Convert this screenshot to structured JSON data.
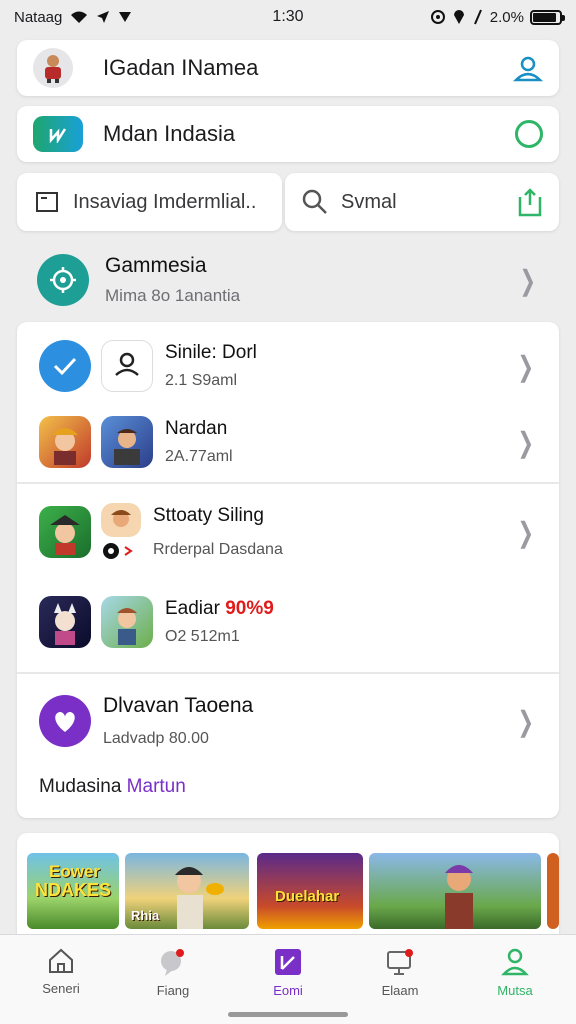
{
  "status_bar": {
    "carrier": "Nataag",
    "time": "1:30",
    "battery_text": "2.0%",
    "battery_level": 0.9
  },
  "profile_card": {
    "name": "IGadan INamea",
    "right_icon": "person-icon"
  },
  "account_card": {
    "name": "Mdan Indasia",
    "right_icon": "circle-icon"
  },
  "search_bar": {
    "left_label": "Insaviag Imdermlial..",
    "right_label": "Svmal",
    "right_icon": "share-icon"
  },
  "games_header": {
    "title": "Gammesia",
    "subtitle": "Mima 8o 1anantia"
  },
  "list": {
    "items": [
      {
        "title": "Sinile: Dorl",
        "subtitle": "2.1 S9aml"
      },
      {
        "title": "Nardan",
        "subtitle": "2A.77aml"
      },
      {
        "title": "Sttoaty Siling",
        "subtitle": "Rrderpal Dasdana"
      },
      {
        "title_prefix": "Eadiar",
        "title_highlight": "90%9",
        "subtitle": "O2 512m1"
      },
      {
        "title": "Dlvavan Taoena",
        "subtitle": "Ladvadp 80.00"
      }
    ],
    "footer_text": "Mudasina",
    "footer_link": "Martun"
  },
  "banner": {
    "tiles": [
      {
        "label_line1": "Eower",
        "label_line2": "NDAKES"
      },
      {
        "label_line1": "Rhia"
      },
      {
        "label_line1": "Duelahar"
      },
      {
        "label_line1": ""
      }
    ]
  },
  "tab_bar": {
    "tabs": [
      {
        "label": "Seneri",
        "icon": "home-icon"
      },
      {
        "label": "Fiang",
        "icon": "chat-icon"
      },
      {
        "label": "Eomi",
        "icon": "wallet-icon",
        "active": true
      },
      {
        "label": "Elaam",
        "icon": "monitor-icon"
      },
      {
        "label": "Mutsa",
        "icon": "person-icon"
      }
    ]
  },
  "colors": {
    "accent_purple": "#7a2fc7",
    "accent_green": "#2fb567",
    "accent_teal": "#1d9f95",
    "highlight_red": "#e01b1b"
  }
}
